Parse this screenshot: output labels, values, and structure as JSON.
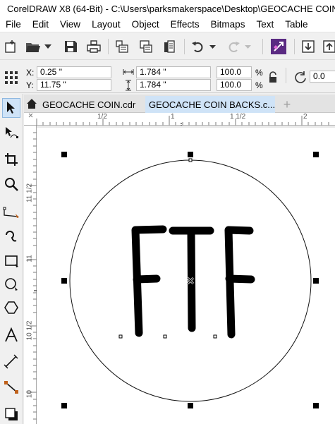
{
  "window": {
    "title": "CorelDRAW X8 (64-Bit) - C:\\Users\\parksmakerspace\\Desktop\\GEOCACHE COIN"
  },
  "menu": [
    "File",
    "Edit",
    "View",
    "Layout",
    "Object",
    "Effects",
    "Bitmaps",
    "Text",
    "Table"
  ],
  "propbar": {
    "x_label": "X:",
    "x_value": "0.25 \"",
    "y_label": "Y:",
    "y_value": "11.75 \"",
    "width_value": "1.784 \"",
    "height_value": "1.784 \"",
    "scale_x": "100.0",
    "scale_y": "100.0",
    "percent_x": "%",
    "percent_y": "%",
    "rotation": "0.0"
  },
  "tabs": [
    {
      "label": "GEOCACHE COIN.cdr",
      "active": false
    },
    {
      "label": "GEOCACHE COIN BACKS.c...",
      "active": true
    }
  ],
  "new_tab_glyph": "+",
  "rulers": {
    "h_labels": [
      "1/2",
      "1",
      "1 1/2",
      "2"
    ],
    "v_labels": [
      "11 1/2",
      "11",
      "10 1/2",
      "10"
    ]
  },
  "artwork": {
    "text": "FTF"
  },
  "icons": {
    "toolbar": [
      "new-document-icon",
      "open-icon",
      "save-icon",
      "print-icon",
      "import-icon",
      "export-icon",
      "publish-icon",
      "undo-icon",
      "redo-icon",
      "pick-icon",
      "import-arrow-icon",
      "export-arrow-icon"
    ],
    "toolbox": [
      "pick-tool-icon",
      "shape-tool-icon",
      "crop-tool-icon",
      "zoom-tool-icon",
      "freehand-tool-icon",
      "artistic-media-icon",
      "rectangle-tool-icon",
      "ellipse-tool-icon",
      "polygon-tool-icon",
      "text-tool-icon",
      "parallel-dimension-icon",
      "connector-tool-icon",
      "drop-shadow-icon"
    ]
  }
}
